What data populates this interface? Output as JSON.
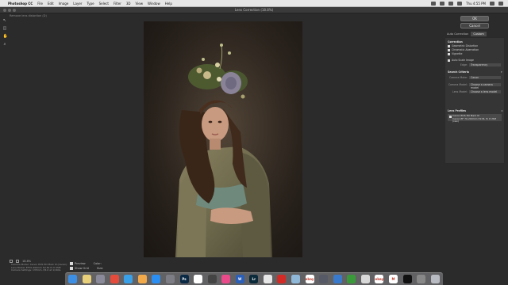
{
  "menubar": {
    "apple": "",
    "app": "Photoshop CC",
    "items": [
      "File",
      "Edit",
      "Image",
      "Layer",
      "Type",
      "Select",
      "Filter",
      "3D",
      "View",
      "Window",
      "Help"
    ],
    "clock": "Thu 4:55 PM"
  },
  "window": {
    "title": "Lens Correction (18.8%)",
    "hint": "Remove lens distortion (D)"
  },
  "tools": [
    "↖",
    "◫",
    "✋",
    "⌕"
  ],
  "status": {
    "zoom": "18.8%",
    "preview_label": "Preview",
    "color_label": "Color:",
    "grid_label": "Show Grid",
    "size_label": "Size:",
    "info_lines": [
      "Camera Model: Canon EOS 5D Mark III (Canon)",
      "Lens Model: EF70-200mm f/2.8L IS II USM",
      "Camera Settings: 135mm, f/4.0 at 1/160s"
    ]
  },
  "right_panel": {
    "ok_label": "OK",
    "cancel_label": "Cancel",
    "tabs": [
      "Auto Correction",
      "Custom"
    ],
    "correction_title": "Correction",
    "checks": [
      "Geometric Distortion",
      "Chromatic Aberration",
      "Vignette"
    ],
    "auto_scale": "Auto Scale Image",
    "edge_label": "Edge:",
    "edge_value": "Transparency",
    "search_title": "Search Criteria",
    "make_label": "Camera Make:",
    "make_value": "Canon",
    "model_label": "Camera Model:",
    "model_value": "Choose a camera model",
    "lens_label": "Lens Model:",
    "lens_value": "Choose a lens model",
    "profiles_title": "Lens Profiles",
    "profile_lines": [
      "Canon EOS 5D Mark III",
      "Canon EF 70-200mm f/2.8L IS II USM (raw)"
    ]
  },
  "dock": {
    "apps": [
      {
        "name": "finder",
        "label": "",
        "color": "#3d8fe6"
      },
      {
        "name": "notes-app",
        "label": "",
        "color": "#e8d07a"
      },
      {
        "name": "launchpad",
        "label": "",
        "color": "#8a8a9a"
      },
      {
        "name": "chrome",
        "label": "",
        "color": "#e44b3b"
      },
      {
        "name": "safari",
        "label": "",
        "color": "#3aa0e8"
      },
      {
        "name": "photos",
        "label": "",
        "color": "#f2a94a"
      },
      {
        "name": "app-store",
        "label": "",
        "color": "#2b8ef2"
      },
      {
        "name": "system-preferences",
        "label": "",
        "color": "#7d7d85"
      },
      {
        "name": "photoshop",
        "label": "Ps",
        "color": "#0a2945"
      },
      {
        "name": "calendar",
        "label": "",
        "color": "#ffffff"
      },
      {
        "name": "calculator",
        "label": "",
        "color": "#444444"
      },
      {
        "name": "itunes",
        "label": "",
        "color": "#e84a8a"
      },
      {
        "name": "word",
        "label": "W",
        "color": "#2b5fb8"
      },
      {
        "name": "lightroom",
        "label": "Lr",
        "color": "#0a2a3a"
      },
      {
        "name": "textedit",
        "label": "",
        "color": "#e6e6e6"
      },
      {
        "name": "acrobat",
        "label": "",
        "color": "#d42a25"
      },
      {
        "name": "preview",
        "label": "",
        "color": "#8fb8d8"
      },
      {
        "name": "ebay",
        "label": "ebay",
        "color": "#ffffff"
      },
      {
        "name": "app-1",
        "label": "",
        "color": "#555a66"
      },
      {
        "name": "app-2",
        "label": "",
        "color": "#3a7acc"
      },
      {
        "name": "camtasia",
        "label": "",
        "color": "#3a9a3a"
      },
      {
        "name": "app-3",
        "label": "",
        "color": "#d8d8d8"
      },
      {
        "name": "ebay-2",
        "label": "ebay",
        "color": "#ffffff"
      },
      {
        "name": "medium",
        "label": "M",
        "color": "#ffffff"
      },
      {
        "name": "app-4",
        "label": "",
        "color": "#111111"
      },
      {
        "name": "app-5",
        "label": "",
        "color": "#888888"
      },
      {
        "name": "trash",
        "label": "",
        "color": "#b8bcc2"
      }
    ]
  }
}
